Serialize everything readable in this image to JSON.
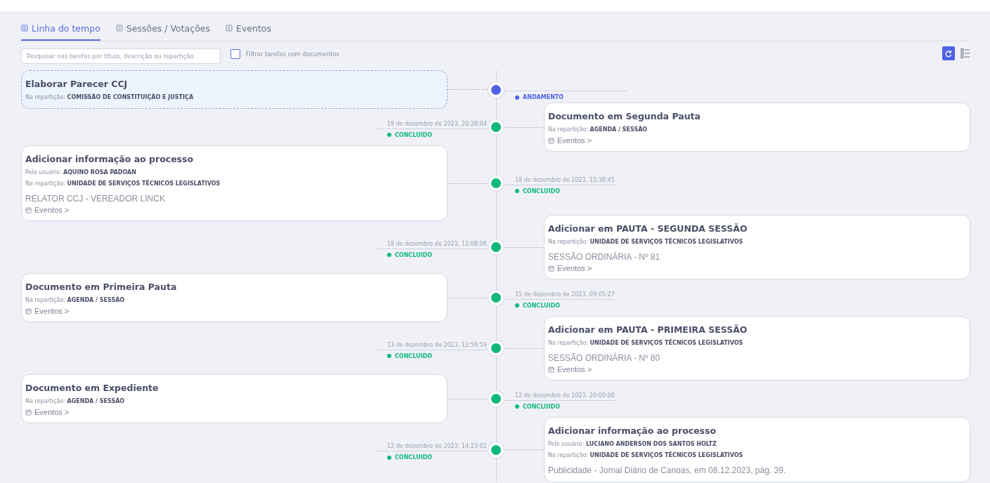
{
  "tabs": [
    {
      "label": "Linha do tempo",
      "selected": true
    },
    {
      "label": "Sessões / Votações",
      "selected": false
    },
    {
      "label": "Eventos",
      "selected": false
    }
  ],
  "search": {
    "placeholder": "Pesquisar nas tarefas por título, descrição ou repartição"
  },
  "filter": {
    "label": "Filtrar tarefas com documentos",
    "checked": false
  },
  "timeline": [
    {
      "status": "ANDAMENTO",
      "kind": "progress",
      "color": "#4f63e6",
      "title": "Elaborar Parecer CCJ",
      "fields": [
        {
          "label": "Na repartição:",
          "value": "COMISSÃO DE CONSTITUIÇÃO E JUSTIÇA"
        }
      ]
    },
    {
      "date": "19 de dezembro de 2023, 20:28:04",
      "status": "CONCLUIDO",
      "kind": "done",
      "color": "#10b97b",
      "title": "Documento em Segunda Pauta",
      "fields": [
        {
          "label": "Na repartição:",
          "value": "AGENDA / SESSÃO"
        }
      ],
      "link": "Eventos >"
    },
    {
      "date": "18 de dezembro de 2023, 15:36:45",
      "status": "CONCLUIDO",
      "kind": "done",
      "color": "#10b97b",
      "title": "Adicionar informação ao processo",
      "fields": [
        {
          "label": "Pelo usuário:",
          "value": "AQUINO ROSA PADOAN"
        },
        {
          "label": "Na repartição:",
          "value": "UNIDADE DE SERVIÇOS TÉCNICOS LEGISLATIVOS"
        }
      ],
      "description": "RELATOR CCJ - VEREADOR LINCK",
      "link": "Eventos >"
    },
    {
      "date": "18 de dezembro de 2023, 12:08:06",
      "status": "CONCLUIDO",
      "kind": "done",
      "color": "#10b97b",
      "title": "Adicionar em PAUTA - SEGUNDA SESSÃO",
      "fields": [
        {
          "label": "Na repartição:",
          "value": "UNIDADE DE SERVIÇOS TÉCNICOS LEGISLATIVOS"
        }
      ],
      "description": "SESSÃO ORDINÁRIA - Nº 81",
      "link": "Eventos >"
    },
    {
      "date": "15 de dezembro de 2023, 09:05:27",
      "status": "CONCLUIDO",
      "kind": "done",
      "color": "#10b97b",
      "title": "Documento em Primeira Pauta",
      "fields": [
        {
          "label": "Na repartição:",
          "value": "AGENDA / SESSÃO"
        }
      ],
      "link": "Eventos >"
    },
    {
      "date": "13 de dezembro de 2023, 12:59:59",
      "status": "CONCLUIDO",
      "kind": "done",
      "color": "#10b97b",
      "title": "Adicionar em PAUTA - PRIMEIRA SESSÃO",
      "fields": [
        {
          "label": "Na repartição:",
          "value": "UNIDADE DE SERVIÇOS TÉCNICOS LEGISLATIVOS"
        }
      ],
      "description": "SESSÃO ORDINÁRIA - Nº 80",
      "link": "Eventos >"
    },
    {
      "date": "12 de dezembro de 2023, 20:00:00",
      "status": "CONCLUIDO",
      "kind": "done",
      "color": "#10b97b",
      "title": "Documento em Expediente",
      "fields": [
        {
          "label": "Na repartição:",
          "value": "AGENDA / SESSÃO"
        }
      ],
      "link": "Eventos >"
    },
    {
      "date": "12 de dezembro de 2023, 14:23:02",
      "status": "CONCLUIDO",
      "kind": "done",
      "color": "#10b97b",
      "title": "Adicionar informação ao processo",
      "fields": [
        {
          "label": "Pelo usuário:",
          "value": "LUCIANO ANDERSON DOS SANTOS HOLTZ"
        },
        {
          "label": "Na repartição:",
          "value": "UNIDADE DE SERVIÇOS TÉCNICOS LEGISLATIVOS"
        }
      ],
      "description": "Publicidade - Jornal Diário de Canoas, em 08.12.2023, pág. 39."
    }
  ]
}
